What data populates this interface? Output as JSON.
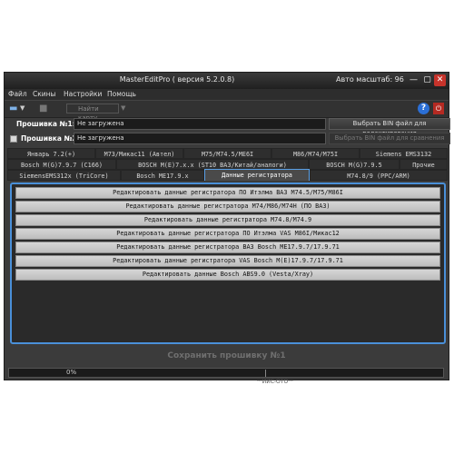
{
  "window": {
    "title": "MasterEditPro ( версия 5.2.0.8)",
    "zoom_label": "Авто масштаб: 96",
    "min_symbol": "—",
    "max_symbol": "▢",
    "close_symbol": "✕"
  },
  "menu": [
    "Файл",
    "Скины",
    "Настройки",
    "Помощь"
  ],
  "toolbar": {
    "find_map_label": "Найти карту",
    "help_symbol": "?",
    "exit_symbol": "⏻"
  },
  "firmware1": {
    "label": "Прошивка №1:",
    "value": "Не загружена",
    "button": "Выбрать BIN файл для редактирования"
  },
  "firmware2": {
    "label": "Прошивка №2:",
    "value": "Не загружена",
    "button": "Выбрать BIN файл для сравнения"
  },
  "tabs_row1": [
    "Январь 7.2(+)",
    "M73/Микас11 (Автел)",
    "M75/M74.5/ME6I",
    "M86/M74/M75I",
    "Siemens EMS3132"
  ],
  "tabs_row2": [
    "Bosch M(G)7.9.7 (C166)",
    "BOSCH M(E)7.x.x (ST10 ВАЗ/Китай/аналоги)",
    "BOSCH M(G)7.9.5",
    "Прочие"
  ],
  "tabs_row3": [
    "SiemensEMS312x (TriCore)",
    "Bosch ME17.9.x",
    "Данные регистратора",
    "M74.8/9 (PPC/ARM)"
  ],
  "register_buttons": [
    "Редактировать данные регистратора ПО Итэлма ВАЗ M74.5/M75/M86I",
    "Редактировать данные регистратора M74/M86/M74H (ПО ВАЗ)",
    "Редактировать данные регистратора M74.8/M74.9",
    "Редактировать данные регистратора ПО Итэлма VAS M86I/Микас12",
    "Редактировать данные регистратора ВАЗ Bosch ME17.9.7/17.9.71",
    "Редактировать данные регистратора VAS Bosch M(E)17.9.7/17.9.71",
    "Редактировать данные Bosch ABS9.0 (Vesta/Xray)"
  ],
  "save_button": "Сохранить прошивку №1",
  "progress": {
    "text": "0%",
    "value": 0
  },
  "below_fragment": "···ИИС-ОТО···"
}
